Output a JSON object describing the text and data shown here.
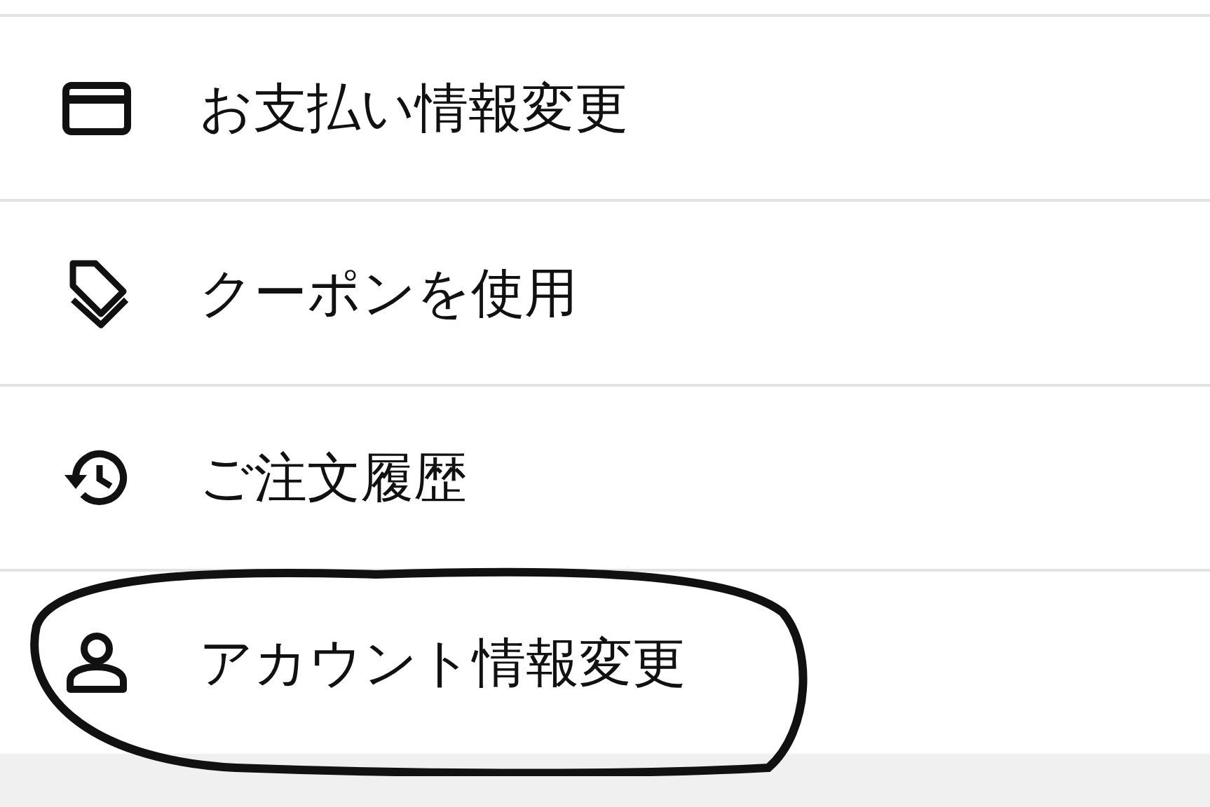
{
  "menu": [
    {
      "label": "お支払い情報変更",
      "kind": "card",
      "circled": false
    },
    {
      "label": "クーポンを使用",
      "kind": "tag",
      "circled": false
    },
    {
      "label": "ご注文履歴",
      "kind": "history",
      "circled": false
    },
    {
      "label": "アカウント情報変更",
      "kind": "person",
      "circled": true
    }
  ]
}
